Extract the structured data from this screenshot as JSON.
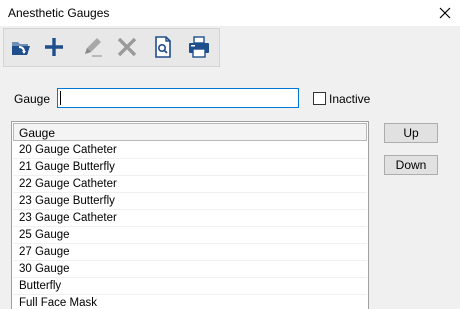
{
  "window": {
    "title": "Anesthetic Gauges",
    "close_icon": "close-icon"
  },
  "toolbar": {
    "buttons": [
      {
        "name": "open-folder-icon",
        "enabled": true
      },
      {
        "name": "add-icon",
        "enabled": true
      },
      {
        "name": "edit-pencil-icon",
        "enabled": false
      },
      {
        "name": "delete-x-icon",
        "enabled": false
      },
      {
        "name": "search-document-icon",
        "enabled": true
      },
      {
        "name": "printer-icon",
        "enabled": true
      }
    ],
    "accent_color": "#1f4e8c",
    "disabled_color": "#9a9a9a"
  },
  "form": {
    "gauge_label": "Gauge",
    "gauge_value": "",
    "inactive_label": "Inactive",
    "inactive_checked": false
  },
  "list": {
    "header": "Gauge",
    "items": [
      "20 Gauge Catheter",
      "21 Gauge Butterfly",
      "22 Gauge Catheter",
      "23 Gauge Butterfly",
      "23 Gauge Catheter",
      "25 Gauge",
      "27 Gauge",
      "30 Gauge",
      "Butterfly",
      "Full Face Mask"
    ]
  },
  "side_buttons": {
    "up_label": "Up",
    "down_label": "Down"
  }
}
